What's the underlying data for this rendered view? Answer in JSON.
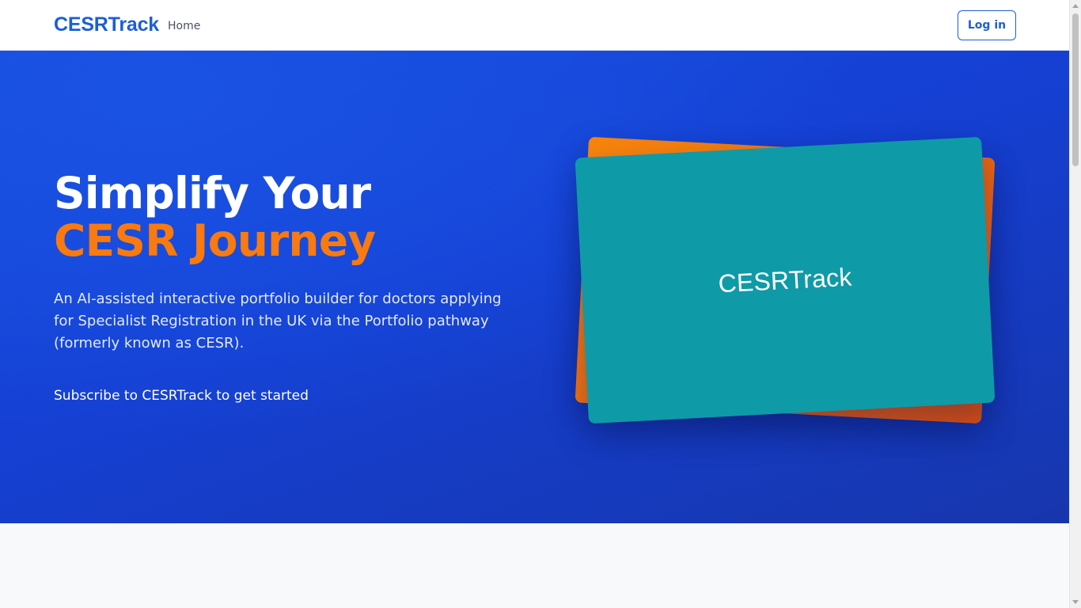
{
  "nav": {
    "brand": "CESRTrack",
    "links": [
      {
        "label": "Home"
      }
    ],
    "login_label": "Log in"
  },
  "hero": {
    "title_line1": "Simplify Your",
    "title_line2": "CESR Journey",
    "description": "An AI-assisted interactive portfolio builder for doctors applying for Specialist Registration in the UK via the Portfolio pathway (formerly known as CESR).",
    "subscribe_text": "Subscribe to CESRTrack to get started",
    "card_label": "CESRTrack"
  },
  "colors": {
    "brand_blue": "#1d5ed8",
    "hero_blue": "#1540d3",
    "accent_orange": "#f97a0f",
    "card_teal": "#0f9aa7"
  }
}
